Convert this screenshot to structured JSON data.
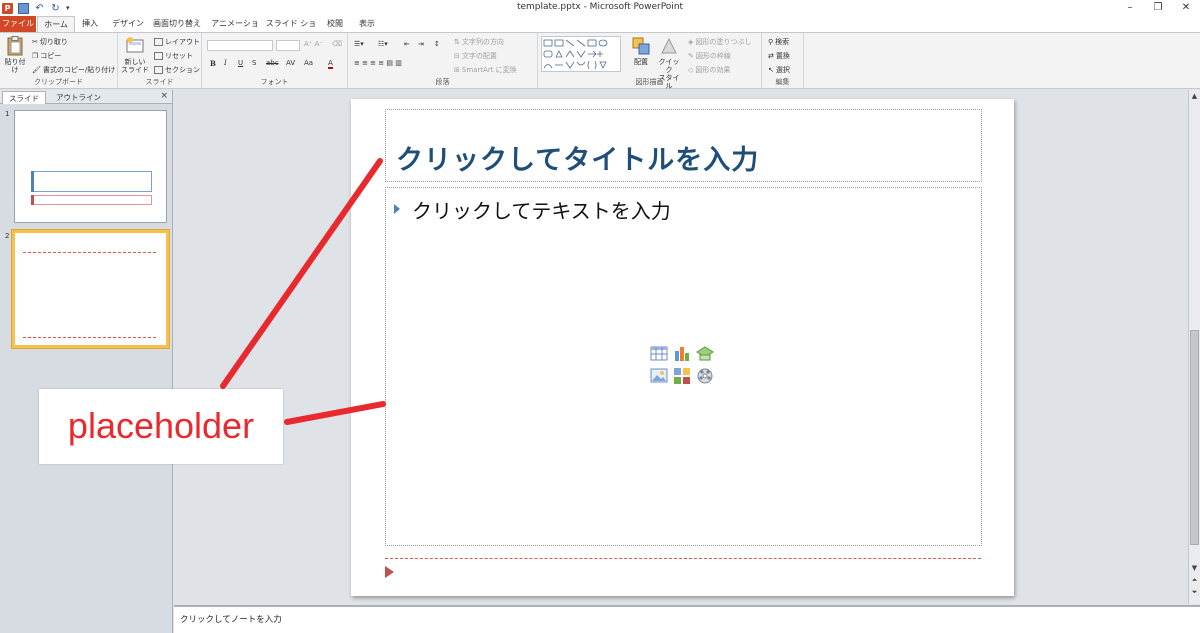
{
  "window": {
    "title": "template.pptx - Microsoft PowerPoint",
    "controls": [
      "–",
      "❐",
      "✕"
    ]
  },
  "qat": {
    "icons": [
      "powerpoint-logo",
      "save-icon",
      "undo-icon",
      "redo-icon"
    ]
  },
  "ribbon_tabs": [
    "ファイル",
    "ホーム",
    "挿入",
    "デザイン",
    "画面切り替え",
    "アニメーション",
    "スライド ショー",
    "校閲",
    "表示"
  ],
  "ribbon": {
    "clipboard": {
      "paste": "貼り付け",
      "cut": "切り取り",
      "copy": "コピー",
      "format_painter": "書式のコピー/貼り付け",
      "label": "クリップボード"
    },
    "slides": {
      "new_slide_line1": "新しい",
      "new_slide_line2": "スライド",
      "layout": "レイアウト",
      "reset": "リセット",
      "section": "セクション",
      "label": "スライド"
    },
    "font": {
      "label": "フォント",
      "bold": "B",
      "italic": "I",
      "underline": "U",
      "strike": "S",
      "shadow": "abc",
      "spacing": "AV",
      "case": "Aa",
      "color": "A"
    },
    "paragraph": {
      "label": "段落",
      "text_direction": "文字列の方向",
      "align_text": "文字の配置",
      "smartart": "SmartArt に変換"
    },
    "drawing": {
      "label": "図形描画",
      "arrange": "配置",
      "quick_styles_line1": "クイック",
      "quick_styles_line2": "スタイル",
      "fill": "図形の塗りつぶし",
      "outline": "図形の枠線",
      "effects": "図形の効果"
    },
    "editing": {
      "label": "編集",
      "find": "検索",
      "replace": "置換",
      "select": "選択"
    }
  },
  "left_pane": {
    "tabs": [
      "スライド",
      "アウトライン"
    ],
    "close": "×",
    "slide_numbers": [
      "1",
      "2"
    ]
  },
  "slide": {
    "title_placeholder": "クリックしてタイトルを入力",
    "body_placeholder": "クリックしてテキストを入力"
  },
  "notes": {
    "placeholder": "クリックしてノートを入力"
  },
  "annotation": {
    "text": "placeholder",
    "color": "#e8292e"
  },
  "colors": {
    "file_tab": "#d24726",
    "title_text": "#1f4e79",
    "bullet": "#4f81bd",
    "footer_accent": "#c0504d",
    "thumb_selected": "#f5c34b"
  }
}
